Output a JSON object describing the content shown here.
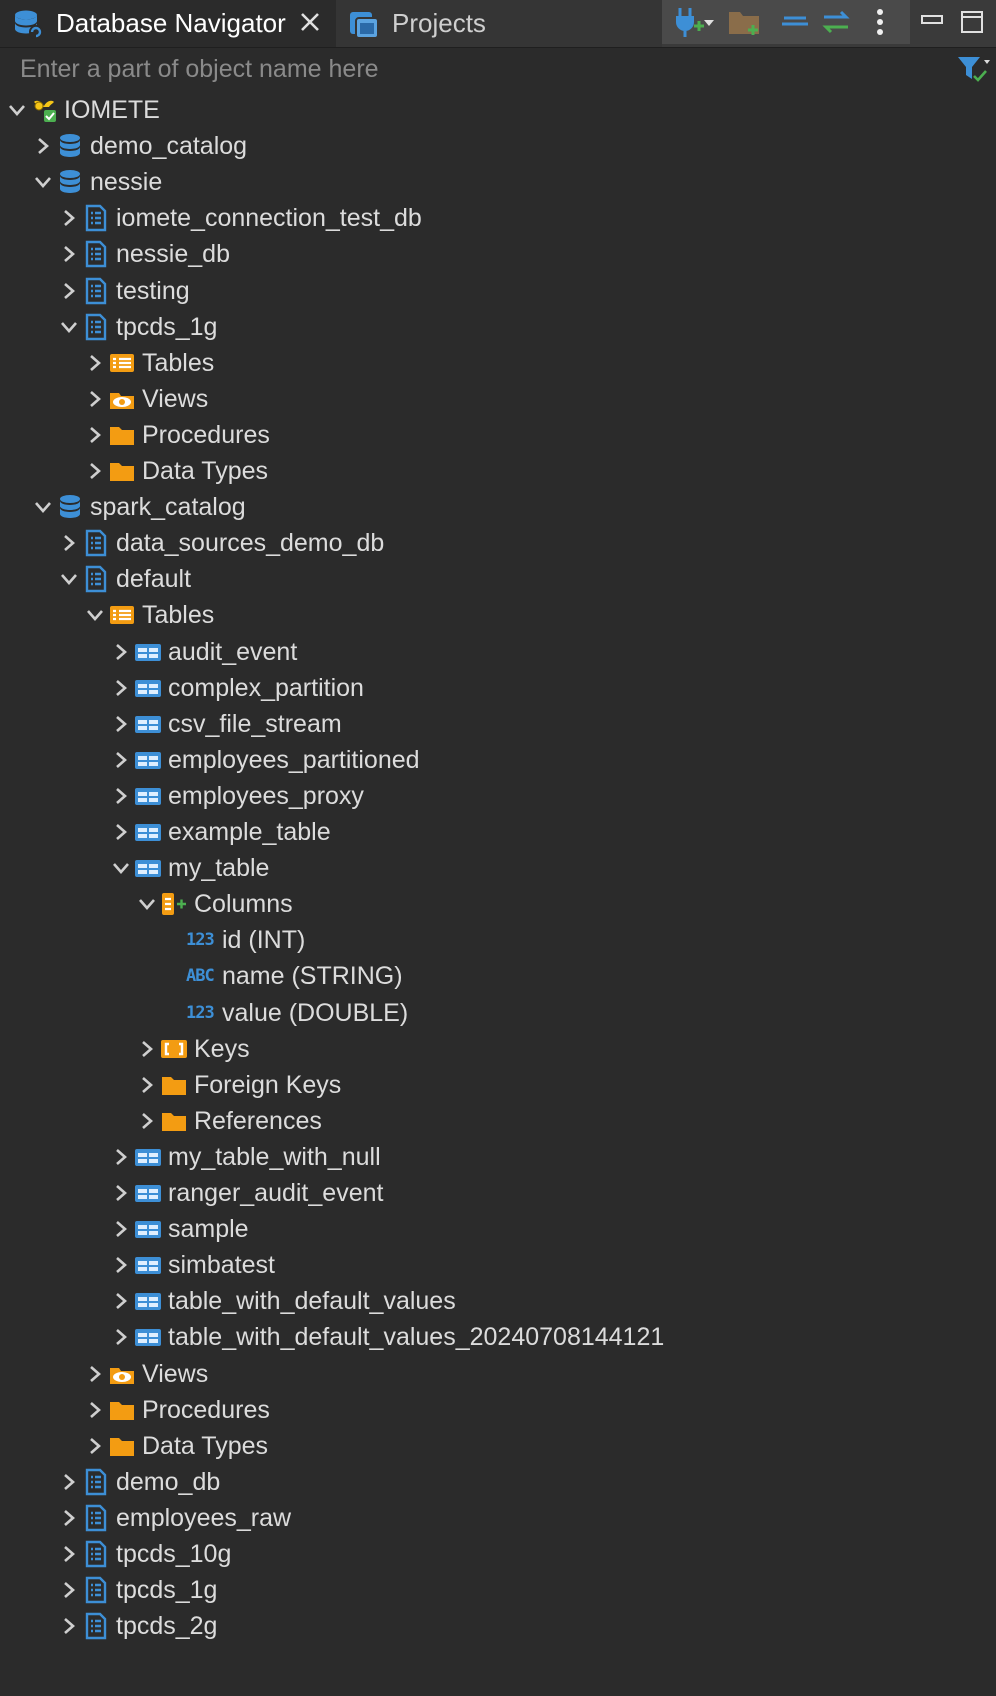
{
  "tabs": {
    "navigator_label": "Database Navigator",
    "projects_label": "Projects"
  },
  "filter": {
    "placeholder": "Enter a part of object name here"
  },
  "tree": {
    "root": "IOMETE",
    "demo_catalog": "demo_catalog",
    "nessie": "nessie",
    "nessie_children": [
      "iomete_connection_test_db",
      "nessie_db",
      "testing",
      "tpcds_1g"
    ],
    "tpcds_1g_children": [
      "Tables",
      "Views",
      "Procedures",
      "Data Types"
    ],
    "spark_catalog": "spark_catalog",
    "data_sources_demo_db": "data_sources_demo_db",
    "default": "default",
    "tables": "Tables",
    "tables_before": [
      "audit_event",
      "complex_partition",
      "csv_file_stream",
      "employees_partitioned",
      "employees_proxy",
      "example_table"
    ],
    "my_table": "my_table",
    "columns": "Columns",
    "column_items": [
      {
        "badge": "123",
        "label": "id (INT)"
      },
      {
        "badge": "ABC",
        "label": "name (STRING)"
      },
      {
        "badge": "123",
        "label": "value (DOUBLE)"
      }
    ],
    "keys": "Keys",
    "foreign_keys": "Foreign Keys",
    "references": "References",
    "tables_after": [
      "my_table_with_null",
      "ranger_audit_event",
      "sample",
      "simbatest",
      "table_with_default_values",
      "table_with_default_values_20240708144121"
    ],
    "views": "Views",
    "procedures": "Procedures",
    "data_types": "Data Types",
    "spark_dbs": [
      "demo_db",
      "employees_raw",
      "tpcds_10g",
      "tpcds_1g",
      "tpcds_2g"
    ]
  },
  "colors": {
    "background": "#2b2b2b",
    "text": "#dcdcdc",
    "db_blue": "#3d8fd6",
    "folder_orange": "#f39c12"
  }
}
